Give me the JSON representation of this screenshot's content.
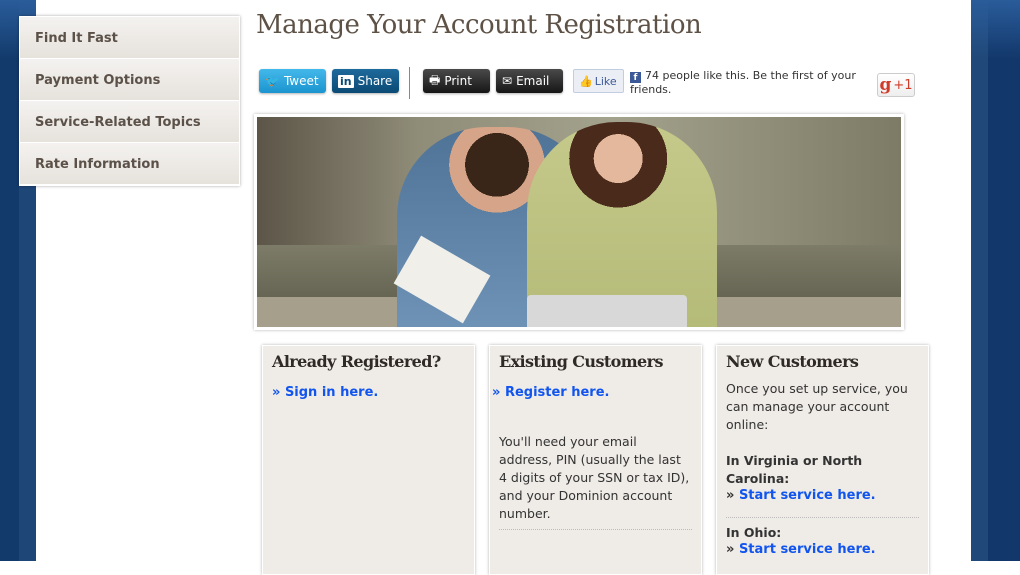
{
  "page_title": "Manage Your Account Registration",
  "nav": {
    "items": [
      {
        "label": "Find It Fast"
      },
      {
        "label": "Payment Options"
      },
      {
        "label": "Service-Related Topics"
      },
      {
        "label": "Rate Information"
      }
    ]
  },
  "share": {
    "tweet": "Tweet",
    "share": "Share",
    "print": "Print",
    "email": "Email",
    "like": "Like",
    "fb_text": "74 people like this. Be the first of your friends.",
    "gplus": "+1"
  },
  "boxes": {
    "already": {
      "title": "Already Registered?",
      "link_prefix": "»",
      "link": "Sign in here."
    },
    "existing": {
      "title": "Existing Customers",
      "link_prefix": "»",
      "link": "Register here.",
      "text": "You'll need your email address, PIN (usually the last 4 digits of your SSN or tax ID), and your Dominion account number."
    },
    "new": {
      "title": "New Customers",
      "intro": "Once you set up service, you can manage your account online:",
      "va_label": "In Virginia or North Carolina:",
      "va_prefix": "»",
      "va_link": "Start service here.",
      "oh_label": "In Ohio:",
      "oh_prefix": "»",
      "oh_link": "Start service here."
    }
  },
  "colors": {
    "link": "#1155ee",
    "frame_blue": "#123a6a",
    "heading": "#5e5247"
  }
}
